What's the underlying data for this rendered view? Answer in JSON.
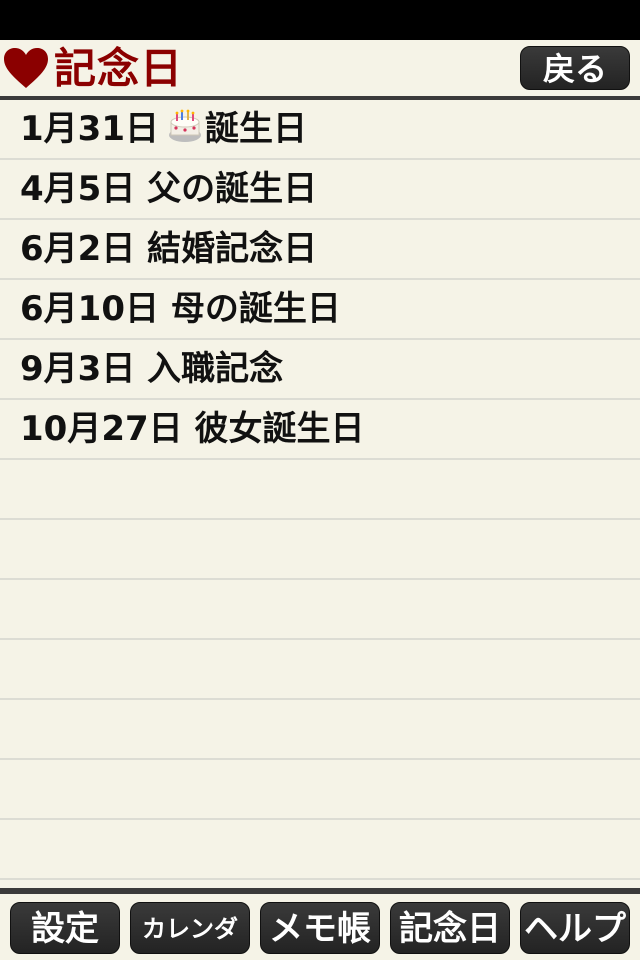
{
  "header": {
    "title": "記念日",
    "back_label": "戻る"
  },
  "anniversaries": [
    {
      "date": "1月31日",
      "icon": "birthday-cake-icon",
      "label": "誕生日"
    },
    {
      "date": "4月5日",
      "label": "父の誕生日"
    },
    {
      "date": "6月2日",
      "label": "結婚記念日"
    },
    {
      "date": "6月10日",
      "label": "母の誕生日"
    },
    {
      "date": "9月3日",
      "label": "入職記念"
    },
    {
      "date": "10月27日",
      "label": "彼女誕生日"
    }
  ],
  "footer": {
    "tabs": [
      {
        "label": "設定"
      },
      {
        "label": "カレンダ"
      },
      {
        "label": "メモ帳"
      },
      {
        "label": "記念日"
      },
      {
        "label": "ヘルプ"
      }
    ]
  },
  "colors": {
    "background": "#f5f3e7",
    "title": "#8b0000",
    "button": "#2b2b2b",
    "rule": "#3a3a3a"
  }
}
